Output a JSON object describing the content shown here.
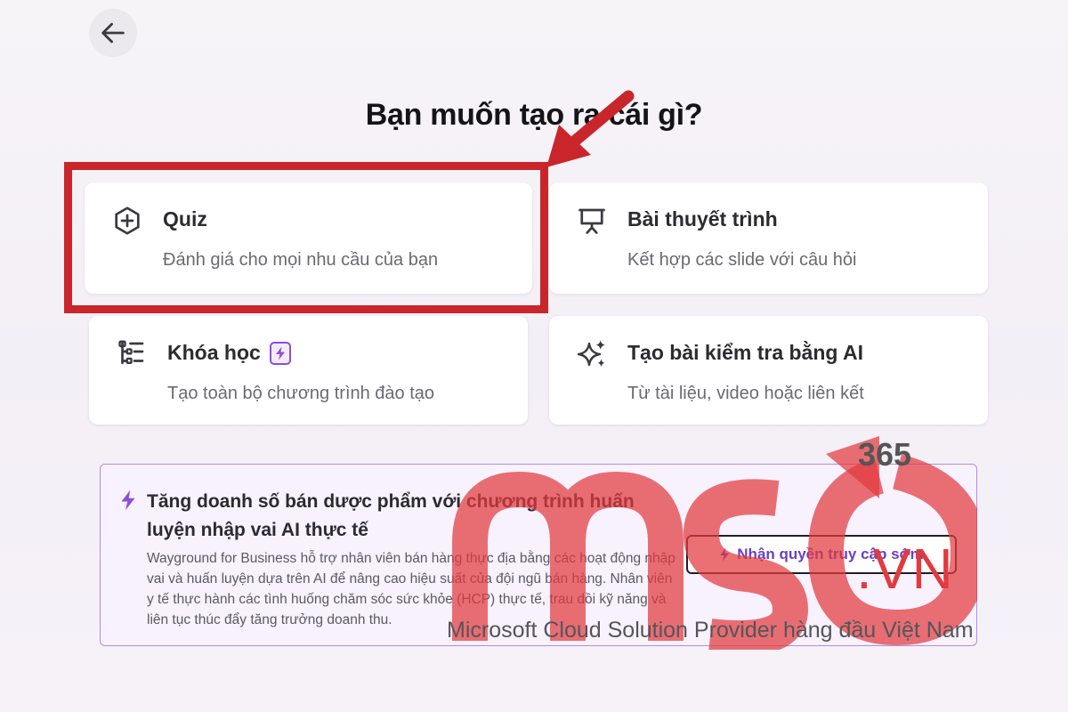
{
  "header": {
    "back_icon": "arrow-left-icon",
    "title": "Bạn muốn tạo ra cái gì?"
  },
  "cards": [
    {
      "icon": "plus-circle-icon",
      "title": "Quiz",
      "desc": "Đánh giá cho mọi nhu cầu của bạn"
    },
    {
      "icon": "presentation-icon",
      "title": "Bài thuyết trình",
      "desc": "Kết hợp các slide với câu hỏi"
    },
    {
      "icon": "course-list-icon",
      "title": "Khóa học",
      "badge_icon": "lightning-badge-icon",
      "desc": "Tạo toàn bộ chương trình đào tạo"
    },
    {
      "icon": "sparkles-icon",
      "title": "Tạo bài kiểm tra bằng AI",
      "desc": "Từ tài liệu, video hoặc liên kết"
    }
  ],
  "promo": {
    "icon": "lightning-icon",
    "title": "Tăng doanh số bán dược phẩm với chương trình huấn luyện nhập vai AI thực tế",
    "body": "Wayground for Business hỗ trợ nhân viên bán hàng thực địa bằng các hoạt động nhập vai và huấn luyện dựa trên AI để nâng cao hiệu suất của đội ngũ bán hàng. Nhân viên y tế thực hành các tình huống chăm sóc sức khỏe (HCP) thực tế, trau dồi kỹ năng và liên tục thúc đẩy tăng trưởng doanh thu.",
    "button_label": "Nhận quyền truy cập sớm"
  },
  "watermark": {
    "number": "365",
    "domain": ".VN",
    "tagline": "Microsoft Cloud Solution Provider hàng đầu Việt Nam"
  },
  "colors": {
    "highlight": "#c8262a",
    "accent_purple": "#8c4fd6",
    "watermark_red": "#e23a3e"
  }
}
